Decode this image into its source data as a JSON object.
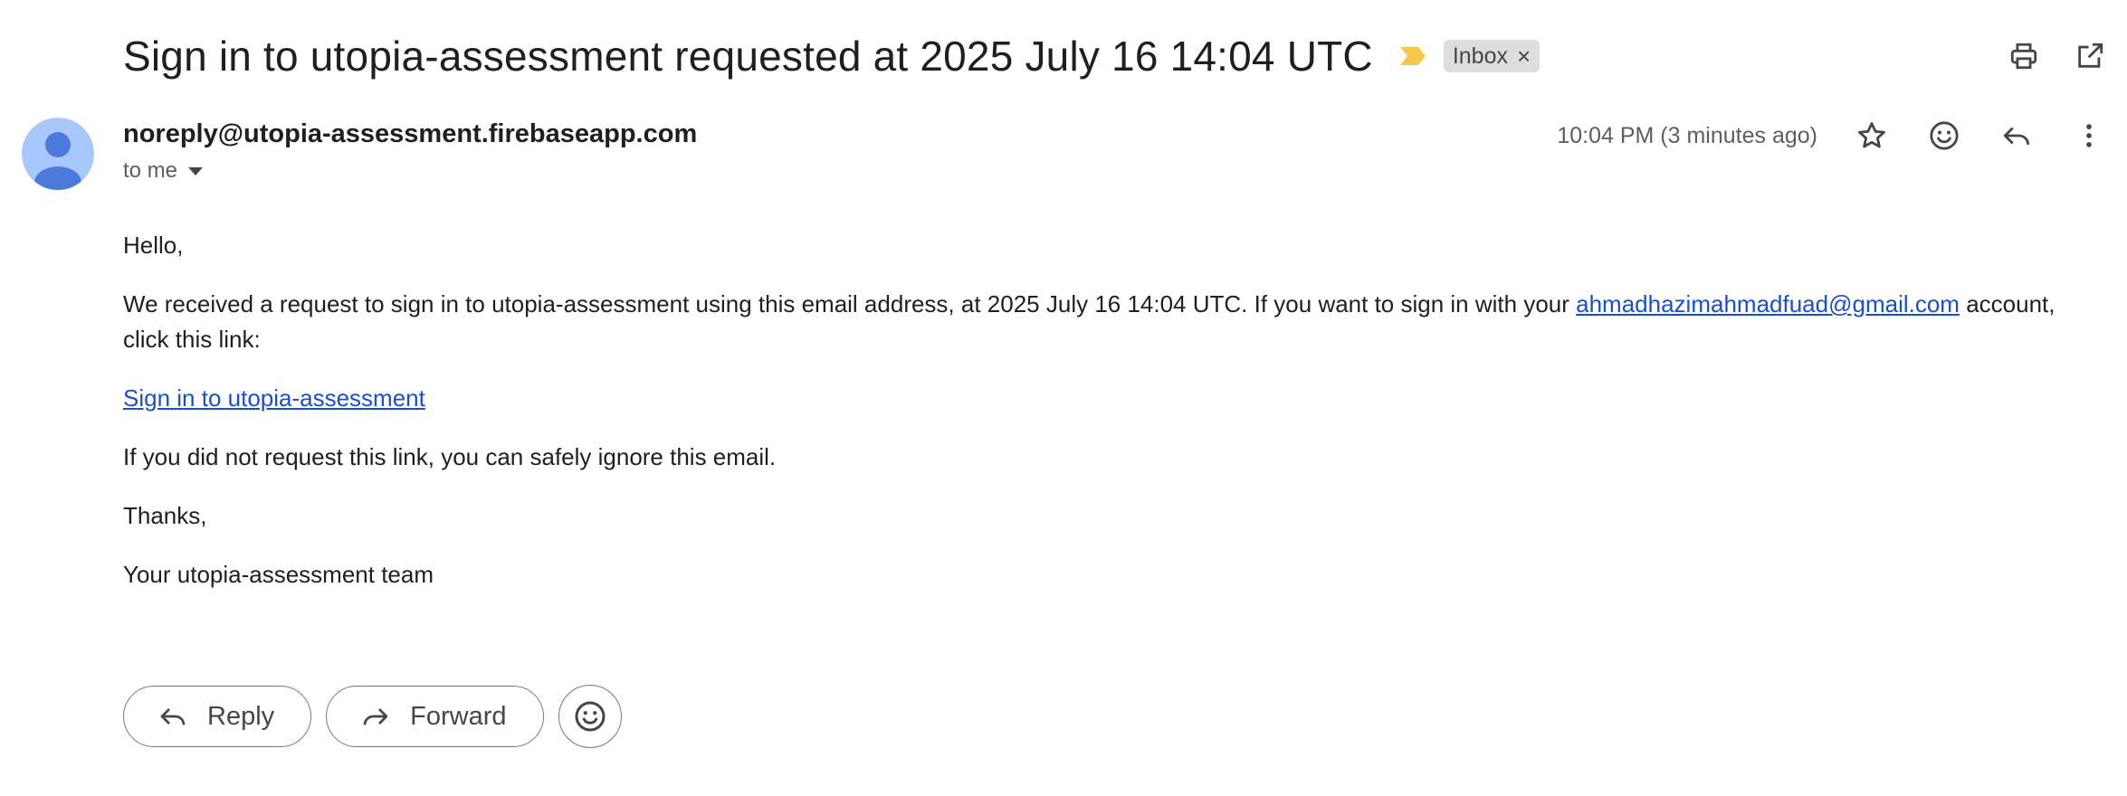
{
  "message": {
    "subject": "Sign in to utopia-assessment requested at 2025 July 16 14:04 UTC",
    "label": "Inbox",
    "label_remove": "×",
    "sender": "noreply@utopia-assessment.firebaseapp.com",
    "recipient": "to me",
    "timestamp": "10:04 PM (3 minutes ago)"
  },
  "toolbar_icons": [
    "print-icon",
    "open-in-new-window-icon",
    "star-icon",
    "emoji-icon",
    "reply-icon",
    "more-vert-icon"
  ],
  "body": {
    "greeting": "Hello,",
    "para1_before": "We received a request to sign in to utopia-assessment using this email address, at 2025 July 16 14:04 UTC. If you want to sign in with your ",
    "para1_link": "ahmadhazimahmadfuad@gmail.com",
    "para1_after": " account, click this link:",
    "signin_link": "Sign in to utopia-assessment",
    "para2": "If you did not request this link, you can safely ignore this email.",
    "thanks": "Thanks,",
    "signature": "Your utopia-assessment team"
  },
  "actions": {
    "reply": "Reply",
    "forward": "Forward"
  },
  "colors": {
    "link": "#1a4fc9",
    "avatar_bg": "#a8c7fa",
    "avatar_fg": "#4a7bdc",
    "importance": "#f2c94c",
    "chip_bg": "#dddddd"
  }
}
